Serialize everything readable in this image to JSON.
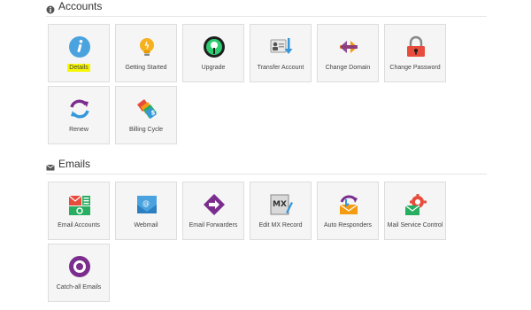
{
  "sections": {
    "accounts": {
      "title": "Accounts",
      "icon": "info-circle-icon",
      "tiles": [
        {
          "label": "Details",
          "icon": "info-icon",
          "highlighted": true
        },
        {
          "label": "Getting Started",
          "icon": "lightbulb-icon"
        },
        {
          "label": "Upgrade",
          "icon": "upgrade-icon"
        },
        {
          "label": "Transfer Account",
          "icon": "transfer-account-icon"
        },
        {
          "label": "Change Domain",
          "icon": "change-domain-icon"
        },
        {
          "label": "Change Password",
          "icon": "padlock-icon"
        },
        {
          "label": "Renew",
          "icon": "renew-icon"
        },
        {
          "label": "Billing Cycle",
          "icon": "billing-tags-icon"
        }
      ]
    },
    "emails": {
      "title": "Emails",
      "icon": "envelope-icon",
      "tiles": [
        {
          "label": "Email Accounts",
          "icon": "email-accounts-icon"
        },
        {
          "label": "Webmail",
          "icon": "webmail-icon"
        },
        {
          "label": "Email Forwarders",
          "icon": "email-forwarders-icon"
        },
        {
          "label": "Edit MX Record",
          "icon": "mx-record-icon",
          "icon_text": "MX"
        },
        {
          "label": "Auto Responders",
          "icon": "auto-responders-icon"
        },
        {
          "label": "Mail Service Control",
          "icon": "mail-service-control-icon"
        },
        {
          "label": "Catch-all Emails",
          "icon": "catch-all-icon"
        }
      ]
    }
  },
  "colors": {
    "highlight": "#f7f700",
    "tile_bg": "#f5f5f5",
    "tile_border": "#dddddd",
    "purple": "#7b2d8e",
    "orange": "#f39c12",
    "green": "#27ae60",
    "blue": "#3498db",
    "red": "#e74c3c"
  }
}
